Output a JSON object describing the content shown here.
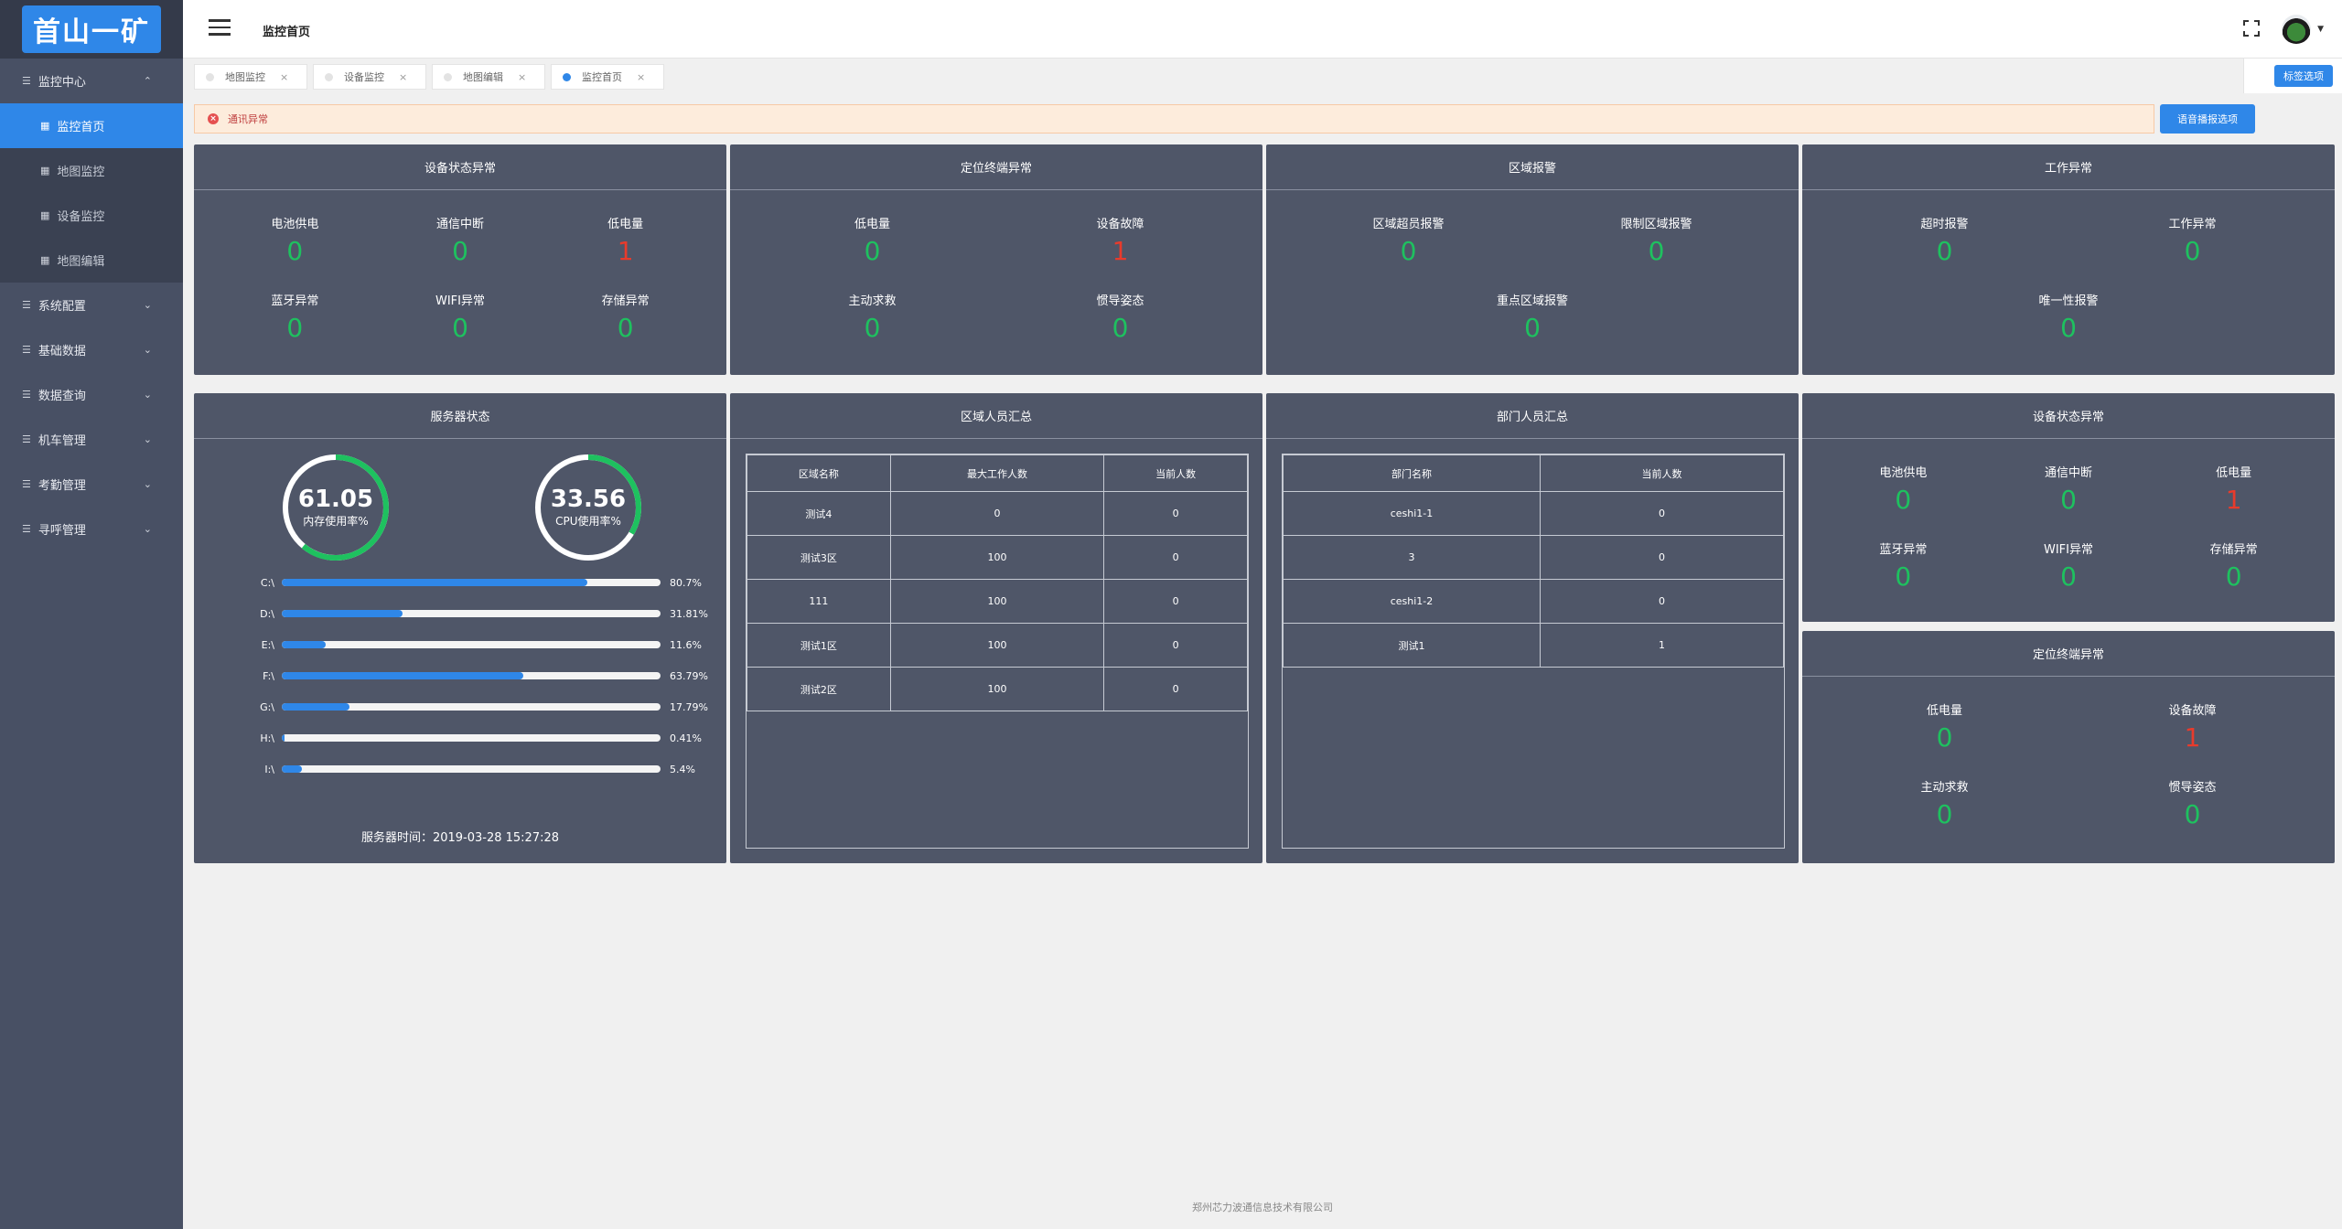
{
  "logo": {
    "text": "首山一矿"
  },
  "sidebar": {
    "items": [
      {
        "label": "监控中心",
        "chevron": "⌃",
        "children": [
          {
            "label": "监控首页",
            "active": true
          },
          {
            "label": "地图监控"
          },
          {
            "label": "设备监控"
          },
          {
            "label": "地图编辑"
          }
        ]
      },
      {
        "label": "系统配置",
        "chevron": "⌄"
      },
      {
        "label": "基础数据",
        "chevron": "⌄"
      },
      {
        "label": "数据查询",
        "chevron": "⌄"
      },
      {
        "label": "机车管理",
        "chevron": "⌄"
      },
      {
        "label": "考勤管理",
        "chevron": "⌄"
      },
      {
        "label": "寻呼管理",
        "chevron": "⌄"
      }
    ]
  },
  "header": {
    "title": "监控首页"
  },
  "tabs": [
    {
      "label": "地图监控"
    },
    {
      "label": "设备监控"
    },
    {
      "label": "地图编辑"
    },
    {
      "label": "监控首页",
      "active": true
    }
  ],
  "tab_options_label": "标签选项",
  "alert": {
    "text": "通讯异常"
  },
  "voice_button": "语音播报选项",
  "colors": {
    "accent": "#2f87e8",
    "ok": "#1ec15f",
    "bad": "#e83b2c",
    "panel": "#4f5668",
    "sidebar": "#485064"
  },
  "panels": {
    "device_status": {
      "title": "设备状态异常",
      "stats": [
        {
          "label": "电池供电",
          "value": "0",
          "status": "ok"
        },
        {
          "label": "通信中断",
          "value": "0",
          "status": "ok"
        },
        {
          "label": "低电量",
          "value": "1",
          "status": "bad"
        },
        {
          "label": "蓝牙异常",
          "value": "0",
          "status": "ok"
        },
        {
          "label": "WIFI异常",
          "value": "0",
          "status": "ok"
        },
        {
          "label": "存储异常",
          "value": "0",
          "status": "ok"
        }
      ]
    },
    "terminal": {
      "title": "定位终端异常",
      "stats": [
        {
          "label": "低电量",
          "value": "0",
          "status": "ok"
        },
        {
          "label": "设备故障",
          "value": "1",
          "status": "bad"
        },
        {
          "label": "主动求救",
          "value": "0",
          "status": "ok"
        },
        {
          "label": "惯导姿态",
          "value": "0",
          "status": "ok"
        }
      ]
    },
    "area_alarm": {
      "title": "区域报警",
      "stats": [
        {
          "label": "区域超员报警",
          "value": "0",
          "status": "ok"
        },
        {
          "label": "限制区域报警",
          "value": "0",
          "status": "ok"
        },
        {
          "label": "重点区域报警",
          "value": "0",
          "status": "ok"
        }
      ]
    },
    "work": {
      "title": "工作异常",
      "stats": [
        {
          "label": "超时报警",
          "value": "0",
          "status": "ok"
        },
        {
          "label": "工作异常",
          "value": "0",
          "status": "ok"
        },
        {
          "label": "唯一性报警",
          "value": "0",
          "status": "ok"
        }
      ]
    },
    "server": {
      "title": "服务器状态",
      "memory": {
        "value": "61.05",
        "label": "内存使用率%",
        "fraction": 0.6105
      },
      "cpu": {
        "value": "33.56",
        "label": "CPU使用率%",
        "fraction": 0.3356
      },
      "disks": [
        {
          "name": "C:\\",
          "pct": "80.7%",
          "value": 80.7
        },
        {
          "name": "D:\\",
          "pct": "31.81%",
          "value": 31.81
        },
        {
          "name": "E:\\",
          "pct": "11.6%",
          "value": 11.6
        },
        {
          "name": "F:\\",
          "pct": "63.79%",
          "value": 63.79
        },
        {
          "name": "G:\\",
          "pct": "17.79%",
          "value": 17.79
        },
        {
          "name": "H:\\",
          "pct": "0.41%",
          "value": 0.41
        },
        {
          "name": "I:\\",
          "pct": "5.4%",
          "value": 5.4
        }
      ],
      "time": "服务器时间：2019-03-28 15:27:28"
    },
    "area_people": {
      "title": "区域人员汇总",
      "headers": [
        "区域名称",
        "最大工作人数",
        "当前人数"
      ],
      "rows": [
        [
          "测试4",
          "0",
          "0"
        ],
        [
          "测试3区",
          "100",
          "0"
        ],
        [
          "111",
          "100",
          "0"
        ],
        [
          "测试1区",
          "100",
          "0"
        ],
        [
          "测试2区",
          "100",
          "0"
        ]
      ]
    },
    "dept_people": {
      "title": "部门人员汇总",
      "headers": [
        "部门名称",
        "当前人数"
      ],
      "rows": [
        [
          "ceshi1-1",
          "0"
        ],
        [
          "3",
          "0"
        ],
        [
          "ceshi1-2",
          "0"
        ],
        [
          "测试1",
          "1"
        ]
      ]
    },
    "device_status2": {
      "title": "设备状态异常",
      "stats": [
        {
          "label": "电池供电",
          "value": "0",
          "status": "ok"
        },
        {
          "label": "通信中断",
          "value": "0",
          "status": "ok"
        },
        {
          "label": "低电量",
          "value": "1",
          "status": "bad"
        },
        {
          "label": "蓝牙异常",
          "value": "0",
          "status": "ok"
        },
        {
          "label": "WIFI异常",
          "value": "0",
          "status": "ok"
        },
        {
          "label": "存储异常",
          "value": "0",
          "status": "ok"
        }
      ]
    },
    "terminal2": {
      "title": "定位终端异常",
      "stats": [
        {
          "label": "低电量",
          "value": "0",
          "status": "ok"
        },
        {
          "label": "设备故障",
          "value": "1",
          "status": "bad"
        },
        {
          "label": "主动求救",
          "value": "0",
          "status": "ok"
        },
        {
          "label": "惯导姿态",
          "value": "0",
          "status": "ok"
        }
      ]
    }
  },
  "footer": "郑州芯力波通信息技术有限公司"
}
